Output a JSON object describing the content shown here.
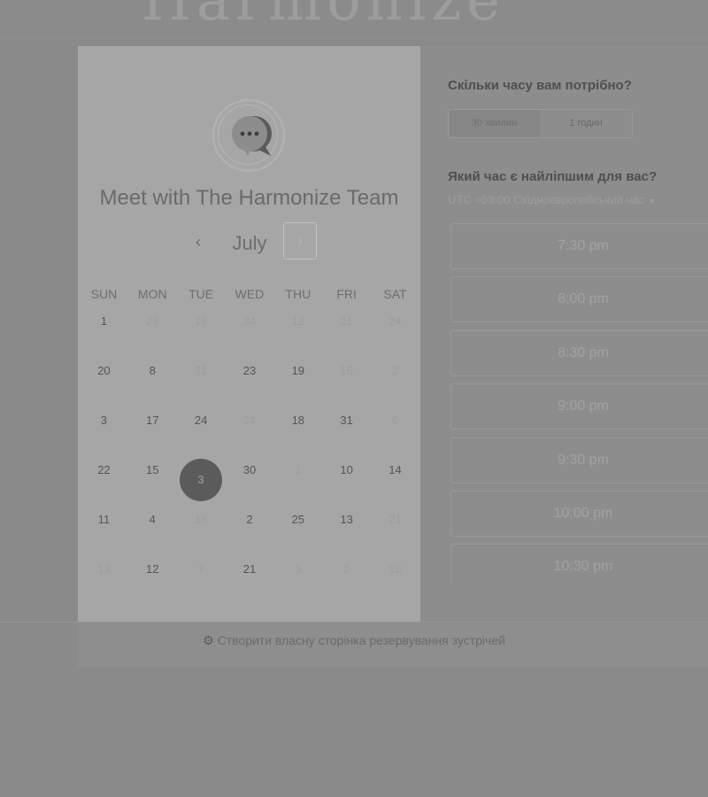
{
  "banner": {
    "title_fragment": "Harmonize"
  },
  "host": {
    "title": "Meet with The Harmonize Team"
  },
  "calendar": {
    "month": "July",
    "prev_symbol": "‹",
    "next_symbol": "›",
    "weekdays": [
      "SUN",
      "MON",
      "TUE",
      "WED",
      "THU",
      "FRI",
      "SAT"
    ],
    "weeks": [
      [
        {
          "d": "1",
          "s": "dark"
        },
        {
          "d": "29",
          "s": "light"
        },
        {
          "d": "19",
          "s": "light"
        },
        {
          "d": "24",
          "s": "light"
        },
        {
          "d": "12",
          "s": "light"
        },
        {
          "d": "21",
          "s": "light"
        },
        {
          "d": "24",
          "s": "light"
        }
      ],
      [
        {
          "d": "20",
          "s": "dark"
        },
        {
          "d": "8",
          "s": "dark"
        },
        {
          "d": "31",
          "s": "light"
        },
        {
          "d": "23",
          "s": "dark"
        },
        {
          "d": "19",
          "s": "dark"
        },
        {
          "d": "16",
          "s": "light"
        },
        {
          "d": "2",
          "s": "light"
        }
      ],
      [
        {
          "d": "3",
          "s": "dark"
        },
        {
          "d": "17",
          "s": "dark"
        },
        {
          "d": "24",
          "s": "dark"
        },
        {
          "d": "24",
          "s": "light"
        },
        {
          "d": "18",
          "s": "dark"
        },
        {
          "d": "31",
          "s": "dark"
        },
        {
          "d": "6",
          "s": "light"
        }
      ],
      [
        {
          "d": "22",
          "s": "dark"
        },
        {
          "d": "15",
          "s": "dark"
        },
        {
          "d": "3",
          "s": "selected"
        },
        {
          "d": "30",
          "s": "dark"
        },
        {
          "d": "1",
          "s": "light"
        },
        {
          "d": "10",
          "s": "dark"
        },
        {
          "d": "14",
          "s": "dark"
        }
      ],
      [
        {
          "d": "11",
          "s": "dark"
        },
        {
          "d": "4",
          "s": "dark"
        },
        {
          "d": "16",
          "s": "light"
        },
        {
          "d": "2",
          "s": "dark"
        },
        {
          "d": "25",
          "s": "dark"
        },
        {
          "d": "13",
          "s": "dark"
        },
        {
          "d": "21",
          "s": "light"
        }
      ],
      [
        {
          "d": "13",
          "s": "light"
        },
        {
          "d": "12",
          "s": "dark"
        },
        {
          "d": "7",
          "s": "light"
        },
        {
          "d": "21",
          "s": "dark"
        },
        {
          "d": "3",
          "s": "light"
        },
        {
          "d": "2",
          "s": "light"
        },
        {
          "d": "18",
          "s": "light"
        }
      ]
    ]
  },
  "booking": {
    "duration_question": "Скільки часу вам потрібно?",
    "duration_options": [
      "30 хвилин",
      "1 годин"
    ],
    "time_question": "Який час є найліпшим для вас?",
    "timezone": "UTC +03:00 Східноєвропейський час",
    "slots": [
      "7:30 pm",
      "8:00 pm",
      "8:30 pm",
      "9:00 pm",
      "9:30 pm",
      "10:00 pm",
      "10:30 pm"
    ]
  },
  "footer": {
    "link_text": "Створити власну сторінка резервування зустрічей"
  },
  "colors": {
    "selected_day": "#5b5b5b",
    "panel": "#a6a6a6",
    "overlay": "#8a8a8a"
  }
}
